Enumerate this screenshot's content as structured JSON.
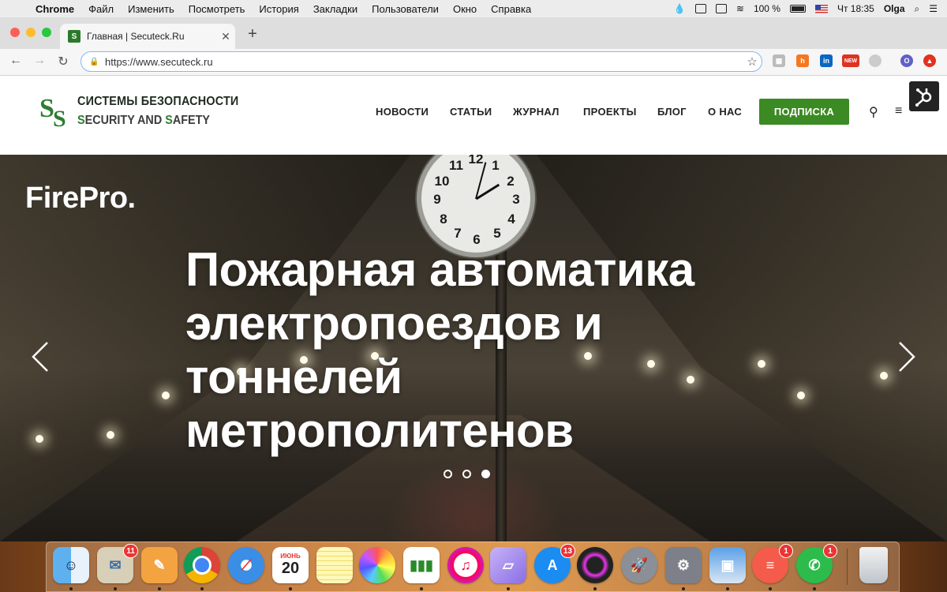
{
  "menubar": {
    "app": "Chrome",
    "items": [
      "Файл",
      "Изменить",
      "Посмотреть",
      "История",
      "Закладки",
      "Пользователи",
      "Окно",
      "Справка"
    ],
    "battery": "100 %",
    "clock": "Чт 18:35",
    "user": "Olga"
  },
  "browser": {
    "tab_title": "Главная | Secuteck.Ru",
    "url": "https://www.secuteck.ru",
    "extensions": [
      "page-icon",
      "hubspot-icon",
      "linkedin-icon",
      "new-badge-icon",
      "circle-icon",
      "profile-o-icon",
      "red-extension-icon"
    ],
    "profile_initial": "O"
  },
  "site": {
    "logo_line1": "СИСТЕМЫ БЕЗОПАСНОСТИ",
    "logo_line2_parts": [
      "S",
      "ECURITY AND ",
      "S",
      "AFETY"
    ],
    "nav": [
      "НОВОСТИ",
      "СТАТЬИ",
      "ЖУРНАЛ",
      "ПРОЕКТЫ",
      "БЛОГ",
      "О НАС"
    ],
    "subscribe": "ПОДПИСКА"
  },
  "hero": {
    "brand": "FirePro.",
    "headline_lines": [
      "Пожарная автоматика",
      "электропоездов и",
      "тоннелей",
      "метрополитенов"
    ],
    "slides_count": 3,
    "active_slide": 3
  },
  "dock": {
    "apps": [
      {
        "name": "Finder",
        "icon": "finder-icon",
        "badge": ""
      },
      {
        "name": "Mail",
        "icon": "mail-icon",
        "badge": "11"
      },
      {
        "name": "Pages",
        "icon": "pages-icon",
        "badge": ""
      },
      {
        "name": "Chrome",
        "icon": "chrome-icon",
        "badge": ""
      },
      {
        "name": "Safari",
        "icon": "safari-icon",
        "badge": ""
      },
      {
        "name": "Calendar",
        "icon": "calendar-icon",
        "badge": "",
        "month": "ИЮНЬ",
        "day": "20"
      },
      {
        "name": "Notes",
        "icon": "notes-icon",
        "badge": ""
      },
      {
        "name": "Photos",
        "icon": "photos-icon",
        "badge": ""
      },
      {
        "name": "Numbers",
        "icon": "numbers-icon",
        "badge": ""
      },
      {
        "name": "iTunes",
        "icon": "itunes-icon",
        "badge": ""
      },
      {
        "name": "Folder",
        "icon": "folder-icon",
        "badge": ""
      },
      {
        "name": "App Store",
        "icon": "app-store-icon",
        "badge": "13"
      },
      {
        "name": "Photo Editor",
        "icon": "camera-app-icon",
        "badge": ""
      },
      {
        "name": "Launchpad",
        "icon": "launchpad-icon",
        "badge": ""
      },
      {
        "name": "System Preferences",
        "icon": "settings-icon",
        "badge": ""
      },
      {
        "name": "Preview",
        "icon": "preview-icon",
        "badge": ""
      },
      {
        "name": "Reminders",
        "icon": "reminders-icon",
        "badge": "1"
      },
      {
        "name": "WhatsApp",
        "icon": "whatsapp-icon",
        "badge": "1"
      },
      {
        "name": "Trash",
        "icon": "trash-icon",
        "badge": ""
      }
    ]
  }
}
